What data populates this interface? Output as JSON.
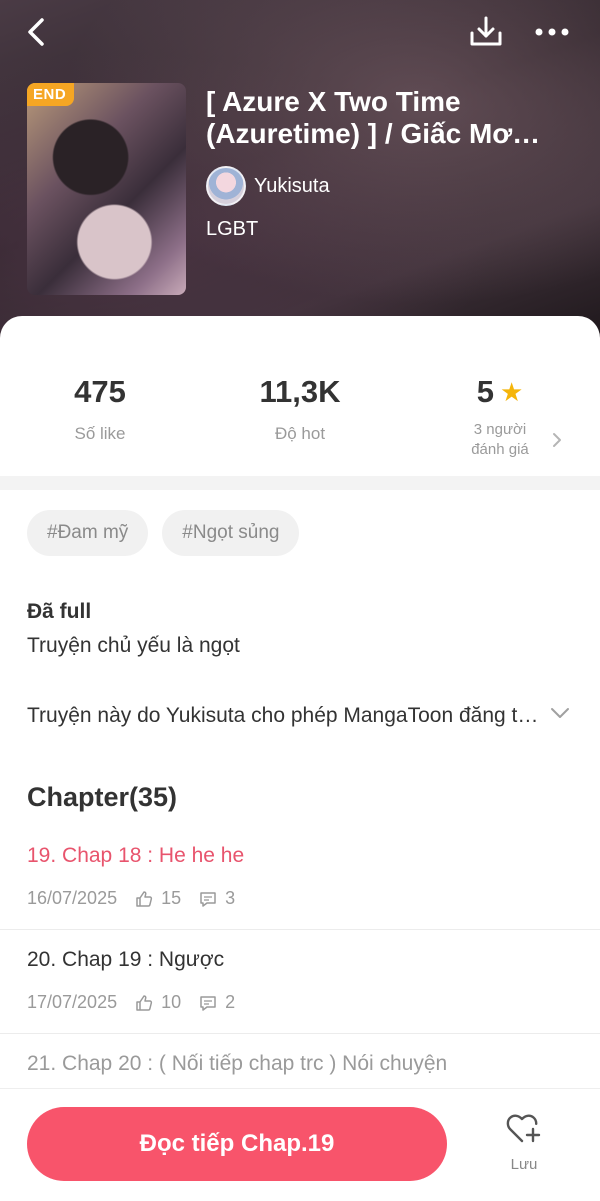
{
  "header": {
    "cover_badge": "END",
    "title": "[ Azure X Two Time (Azuretime) ] / Giấc Mơ Ngọt Ngào",
    "author": "Yukisuta",
    "genre": "LGBT"
  },
  "stats": {
    "likes_value": "475",
    "likes_label": "Số like",
    "hot_value": "11,3K",
    "hot_label": "Độ hot",
    "rating_value": "5",
    "rating_label_1": "3 người",
    "rating_label_2": "đánh giá"
  },
  "tags": [
    "#Đam mỹ",
    "#Ngọt sủng"
  ],
  "info": {
    "status": "Đã full",
    "summary": "Truyện chủ yếu là ngọt",
    "description": "Truyện này do Yukisuta cho phép MangaToon đăng tải độc quyền"
  },
  "chapters": {
    "heading": "Chapter(35)",
    "items": [
      {
        "title": "19. Chap 18 : He he he",
        "date": "16/07/2025",
        "likes": "15",
        "comments": "3"
      },
      {
        "title": "20. Chap 19 : Ngược",
        "date": "17/07/2025",
        "likes": "10",
        "comments": "2"
      },
      {
        "title": "21. Chap 20 : ( Nối tiếp chap trc ) Nói chuyện",
        "date": "",
        "likes": "",
        "comments": ""
      }
    ]
  },
  "bottom": {
    "read_button": "Đọc tiếp Chap.19",
    "save_label": "Lưu"
  },
  "colors": {
    "accent": "#f8546b",
    "active_chapter": "#e8546d",
    "star": "#f5b50a",
    "badge": "#f5a623"
  }
}
